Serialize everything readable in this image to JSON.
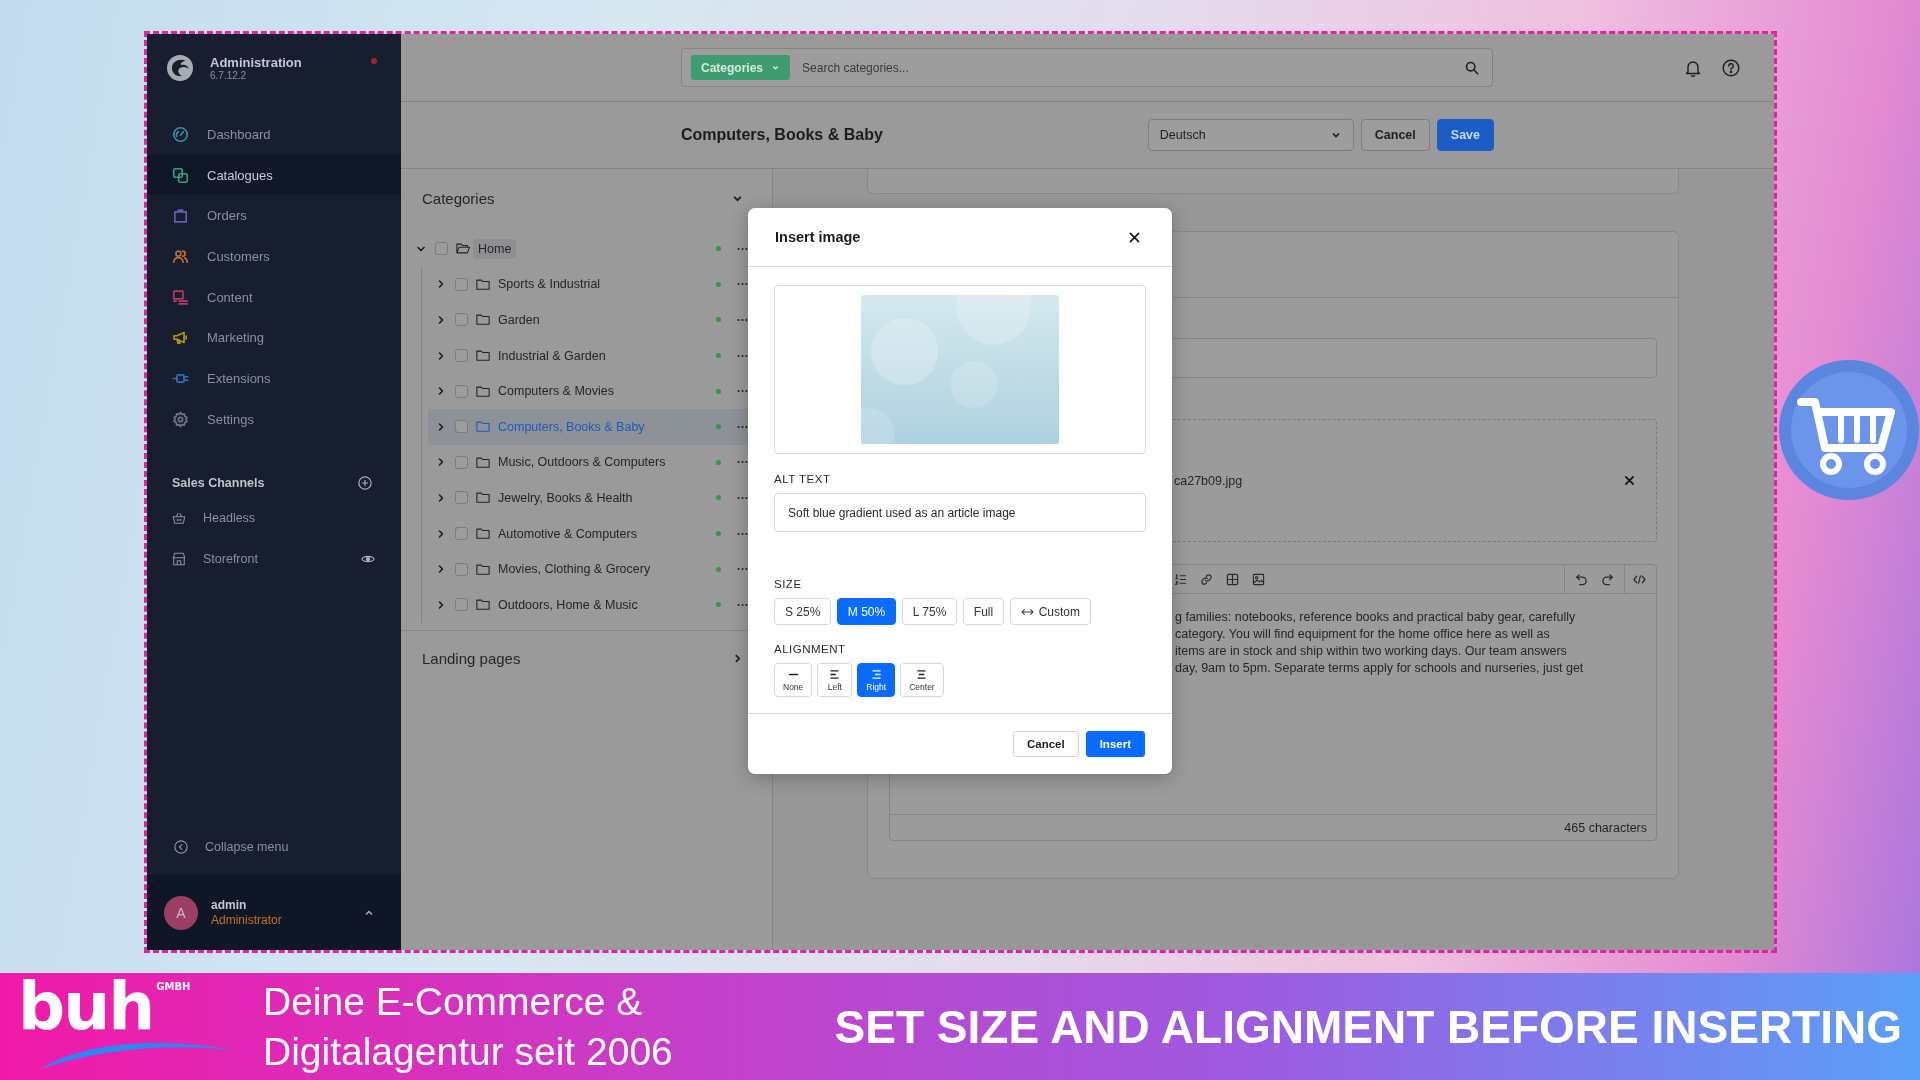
{
  "sidebar": {
    "app_name": "Administration",
    "version": "6.7.12.2",
    "nav": [
      {
        "label": "Dashboard",
        "selected": false,
        "color": "#3b8ea5"
      },
      {
        "label": "Catalogues",
        "selected": true,
        "color": "#32a173"
      },
      {
        "label": "Orders",
        "selected": false,
        "color": "#6b58b8"
      },
      {
        "label": "Customers",
        "selected": false,
        "color": "#c46e2c"
      },
      {
        "label": "Content",
        "selected": false,
        "color": "#b83a68"
      },
      {
        "label": "Marketing",
        "selected": false,
        "color": "#b09612"
      },
      {
        "label": "Extensions",
        "selected": false,
        "color": "#2a73b8"
      },
      {
        "label": "Settings",
        "selected": false,
        "color": "#6e7482"
      }
    ],
    "sales_channels": {
      "title": "Sales Channels",
      "items": [
        {
          "label": "Headless",
          "kind": "headless",
          "selected": false
        },
        {
          "label": "Storefront",
          "kind": "storefront",
          "selected": false
        }
      ]
    },
    "collapse_label": "Collapse menu",
    "user": {
      "initial": "A",
      "name": "admin",
      "role": "Administrator"
    }
  },
  "top_bar": {
    "search": {
      "module": "Categories",
      "placeholder": "Search categories..."
    }
  },
  "header": {
    "title": "Computers, Books & Baby",
    "language": "Deutsch",
    "buttons": [
      {
        "label": "Cancel",
        "kind": "secondary"
      },
      {
        "label": "Save",
        "kind": "primary"
      }
    ]
  },
  "categories_panel": {
    "title": "Categories",
    "expanded": true,
    "tree": [
      {
        "label": "Home",
        "expanded": true,
        "checked": false,
        "selected": false,
        "highlighted": true,
        "active": true,
        "children": [
          {
            "label": "Sports & Industrial",
            "expanded": false,
            "checked": false,
            "selected": false,
            "highlighted": false,
            "active": true
          },
          {
            "label": "Garden",
            "expanded": false,
            "checked": false,
            "selected": false,
            "highlighted": false,
            "active": true
          },
          {
            "label": "Industrial & Garden",
            "expanded": false,
            "checked": false,
            "selected": false,
            "highlighted": false,
            "active": true
          },
          {
            "label": "Computers & Movies",
            "expanded": false,
            "checked": false,
            "selected": false,
            "highlighted": false,
            "active": true
          },
          {
            "label": "Computers, Books & Baby",
            "expanded": false,
            "checked": false,
            "selected": true,
            "highlighted": false,
            "active": true
          },
          {
            "label": "Music, Outdoors & Computers",
            "expanded": false,
            "checked": false,
            "selected": false,
            "highlighted": false,
            "active": true
          },
          {
            "label": "Jewelry, Books & Health",
            "expanded": false,
            "checked": false,
            "selected": false,
            "highlighted": false,
            "active": true
          },
          {
            "label": "Automotive & Computers",
            "expanded": false,
            "checked": false,
            "selected": false,
            "highlighted": false,
            "active": true
          },
          {
            "label": "Movies, Clothing & Grocery",
            "expanded": false,
            "checked": false,
            "selected": false,
            "highlighted": false,
            "active": true
          },
          {
            "label": "Outdoors, Home & Music",
            "expanded": false,
            "checked": false,
            "selected": false,
            "highlighted": false,
            "active": true
          }
        ]
      }
    ]
  },
  "landing_pages": {
    "title": "Landing pages",
    "expanded": false
  },
  "content": {
    "file_name": "ca27b09.jpg",
    "editor": {
      "lines": [
        "g families: notebooks, reference books and practical baby gear, carefully",
        "category. You will find equipment for the home office here as well as",
        "items are in stock and ship within two working days. Our team answers",
        "day, 9am to 5pm. Separate terms apply for schools and nurseries, just get"
      ],
      "char_count": "465 characters"
    }
  },
  "dialog": {
    "title": "Insert image",
    "alt_label": "ALT TEXT",
    "alt_value": "Soft blue gradient used as an article image",
    "size_label": "SIZE",
    "sizes": [
      {
        "label": "S 25%",
        "kind": "preset",
        "selected": false
      },
      {
        "label": "M 50%",
        "kind": "preset",
        "selected": true
      },
      {
        "label": "L 75%",
        "kind": "preset",
        "selected": false
      },
      {
        "label": "Full",
        "kind": "preset",
        "selected": false
      },
      {
        "label": "Custom",
        "kind": "custom",
        "selected": false
      }
    ],
    "alignment_label": "ALIGNMENT",
    "alignments": [
      {
        "label": "None",
        "selected": false
      },
      {
        "label": "Left",
        "selected": false
      },
      {
        "label": "Right",
        "selected": true
      },
      {
        "label": "Center",
        "selected": false
      }
    ],
    "buttons": [
      {
        "label": "Cancel",
        "kind": "secondary"
      },
      {
        "label": "Insert",
        "kind": "primary"
      }
    ]
  },
  "banner": {
    "logo": "buh",
    "logo_suffix": "GMBH",
    "tagline": "Deine E-Commerce & Digitalagentur seit 2006",
    "headline": "SET SIZE AND ALIGNMENT BEFORE INSERTING"
  }
}
